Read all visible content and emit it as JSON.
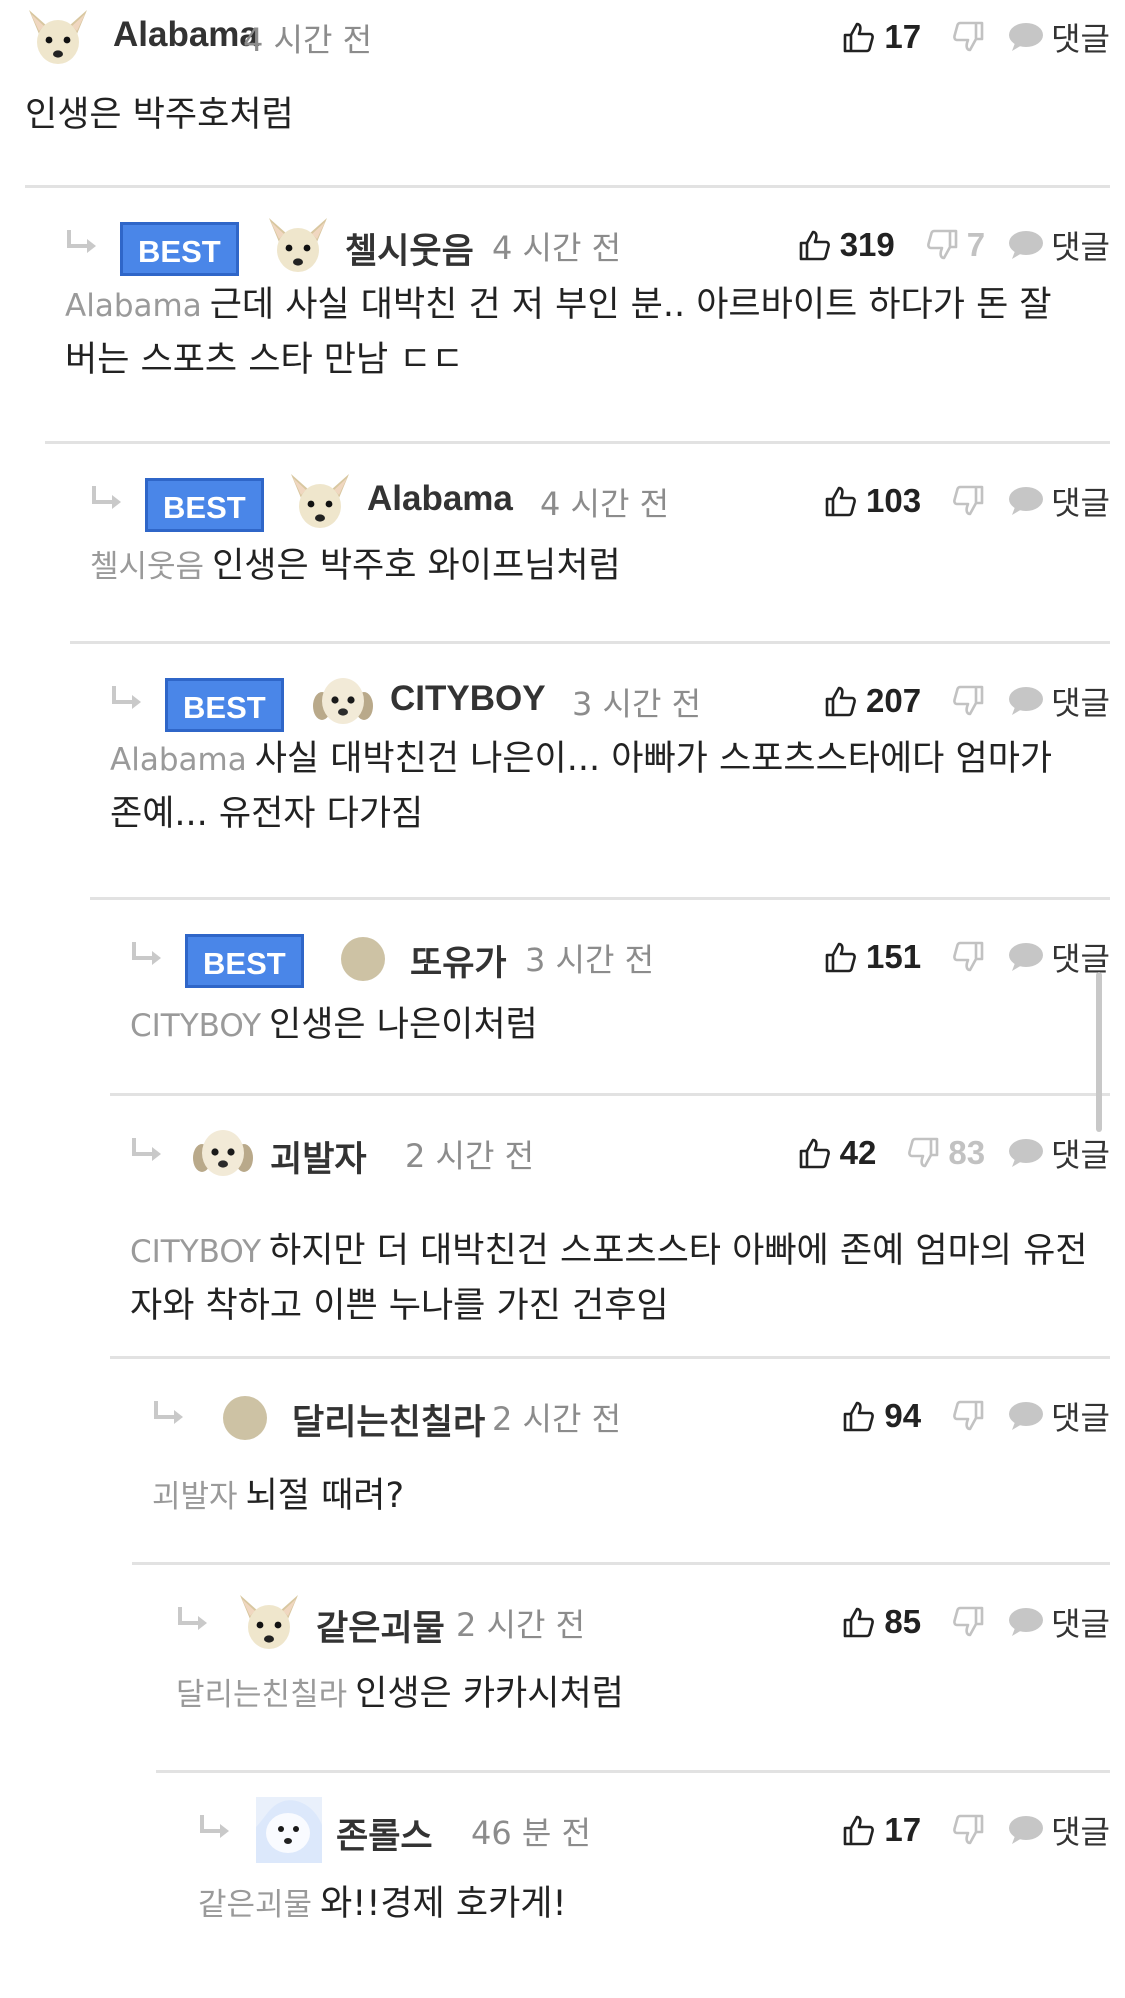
{
  "comments": [
    {
      "user": "Alabama",
      "time": "4 시간 전",
      "likes": "17",
      "dislikes": "",
      "reply_label": "댓글",
      "best": "",
      "mention": "",
      "text": "인생은 박주호처럼",
      "avatar": "chihuahua-avatar-icon"
    },
    {
      "user": "첼시웃음",
      "time": "4 시간 전",
      "likes": "319",
      "dislikes": "7",
      "reply_label": "댓글",
      "best": "BEST",
      "mention": "Alabama",
      "text": "근데 사실 대박친 건 저 부인 분.. 아르바이트 하다가 돈 잘 버는 스포츠 스타 만남 ㄷㄷ",
      "avatar": "chihuahua-avatar-icon"
    },
    {
      "user": "Alabama",
      "time": "4 시간 전",
      "likes": "103",
      "dislikes": "",
      "reply_label": "댓글",
      "best": "BEST",
      "mention": "첼시웃음",
      "text": "인생은 박주호 와이프님처럼",
      "avatar": "chihuahua-avatar-icon"
    },
    {
      "user": "CITYBOY",
      "time": "3 시간 전",
      "likes": "207",
      "dislikes": "",
      "reply_label": "댓글",
      "best": "BEST",
      "mention": "Alabama",
      "text": "사실 대박친건 나은이... 아빠가 스포츠스타에다 엄마가 존예... 유전자 다가짐",
      "avatar": "puppy-avatar-icon"
    },
    {
      "user": "또유가",
      "time": "3 시간 전",
      "likes": "151",
      "dislikes": "",
      "reply_label": "댓글",
      "best": "BEST",
      "mention": "CITYBOY",
      "text": "인생은 나은이처럼",
      "avatar": "default-avatar-icon"
    },
    {
      "user": "괴발자",
      "time": "2 시간 전",
      "likes": "42",
      "dislikes": "83",
      "reply_label": "댓글",
      "best": "",
      "mention": "CITYBOY",
      "text": "하지만 더 대박친건 스포츠스타 아빠에 존예 엄마의 유전자와 착하고 이쁜 누나를 가진 건후임",
      "avatar": "puppy-avatar-icon"
    },
    {
      "user": "달리는친칠라",
      "time": "2 시간 전",
      "likes": "94",
      "dislikes": "",
      "reply_label": "댓글",
      "best": "",
      "mention": "괴발자",
      "text": "뇌절 때려?",
      "avatar": "default-avatar-icon"
    },
    {
      "user": "같은괴물",
      "time": "2 시간 전",
      "likes": "85",
      "dislikes": "",
      "reply_label": "댓글",
      "best": "",
      "mention": "달리는친칠라",
      "text": "인생은 카카시처럼",
      "avatar": "chihuahua-avatar-icon"
    },
    {
      "user": "존롤스",
      "time": "46 분 전",
      "likes": "17",
      "dislikes": "",
      "reply_label": "댓글",
      "best": "",
      "mention": "같은괴물",
      "text": "와!!경제 호카게!",
      "avatar": "white-dog-avatar-icon"
    }
  ],
  "colors": {
    "best_badge": "#4a86e8",
    "mention": "#9a9a9a",
    "muted": "#c2c2c2"
  }
}
